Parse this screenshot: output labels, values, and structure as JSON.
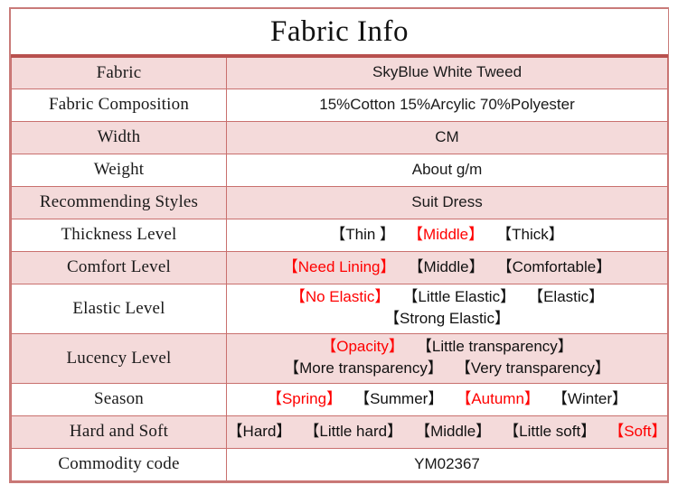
{
  "title": "Fabric Info",
  "colors": {
    "border": "#c9706e",
    "title_rule": "#b8504e",
    "row_tint": "#f4dada",
    "selected": "#ff0000",
    "text": "#1a1a1a"
  },
  "rows": [
    {
      "label": "Fabric",
      "type": "text",
      "value": "SkyBlue White Tweed",
      "tint": true
    },
    {
      "label": "Fabric Composition",
      "type": "text",
      "value": "15%Cotton 15%Arcylic 70%Polyester",
      "tint": false
    },
    {
      "label": "Width",
      "type": "text",
      "value": "CM",
      "tint": true
    },
    {
      "label": "Weight",
      "type": "text",
      "value": "About g/m",
      "tint": false
    },
    {
      "label": "Recommending Styles",
      "type": "text",
      "value": "Suit Dress",
      "tint": true
    },
    {
      "label": "Thickness Level",
      "type": "options",
      "tint": false,
      "lines": [
        [
          {
            "text": "【Thin 】",
            "selected": false
          },
          {
            "text": "【Middle】",
            "selected": true
          },
          {
            "text": "【Thick】",
            "selected": false
          }
        ]
      ]
    },
    {
      "label": "Comfort Level",
      "type": "options",
      "tint": true,
      "lines": [
        [
          {
            "text": "【Need Lining】",
            "selected": true
          },
          {
            "text": "【Middle】",
            "selected": false
          },
          {
            "text": "【Comfortable】",
            "selected": false
          }
        ]
      ]
    },
    {
      "label": "Elastic Level",
      "type": "options",
      "tint": false,
      "tall": true,
      "lines": [
        [
          {
            "text": "【No Elastic】",
            "selected": true
          },
          {
            "text": "【Little Elastic】",
            "selected": false
          },
          {
            "text": "【Elastic】",
            "selected": false
          }
        ],
        [
          {
            "text": "【Strong Elastic】",
            "selected": false
          }
        ]
      ]
    },
    {
      "label": "Lucency Level",
      "type": "options",
      "tint": true,
      "tall": true,
      "lines": [
        [
          {
            "text": "【Opacity】",
            "selected": true
          },
          {
            "text": "【Little transparency】",
            "selected": false
          }
        ],
        [
          {
            "text": "【More transparency】",
            "selected": false
          },
          {
            "text": "【Very transparency】",
            "selected": false
          }
        ]
      ]
    },
    {
      "label": "Season",
      "type": "options",
      "tint": false,
      "lines": [
        [
          {
            "text": "【Spring】",
            "selected": true
          },
          {
            "text": "【Summer】",
            "selected": false
          },
          {
            "text": "【Autumn】",
            "selected": true
          },
          {
            "text": "【Winter】",
            "selected": false
          }
        ]
      ]
    },
    {
      "label": "Hard and Soft",
      "type": "options",
      "tint": true,
      "lines": [
        [
          {
            "text": "【Hard】",
            "selected": false
          },
          {
            "text": "【Little hard】",
            "selected": false
          },
          {
            "text": "【Middle】",
            "selected": false
          },
          {
            "text": "【Little soft】",
            "selected": false
          },
          {
            "text": "【Soft】",
            "selected": true
          }
        ]
      ]
    },
    {
      "label": "Commodity code",
      "type": "text",
      "value": "YM02367",
      "tint": false
    }
  ]
}
